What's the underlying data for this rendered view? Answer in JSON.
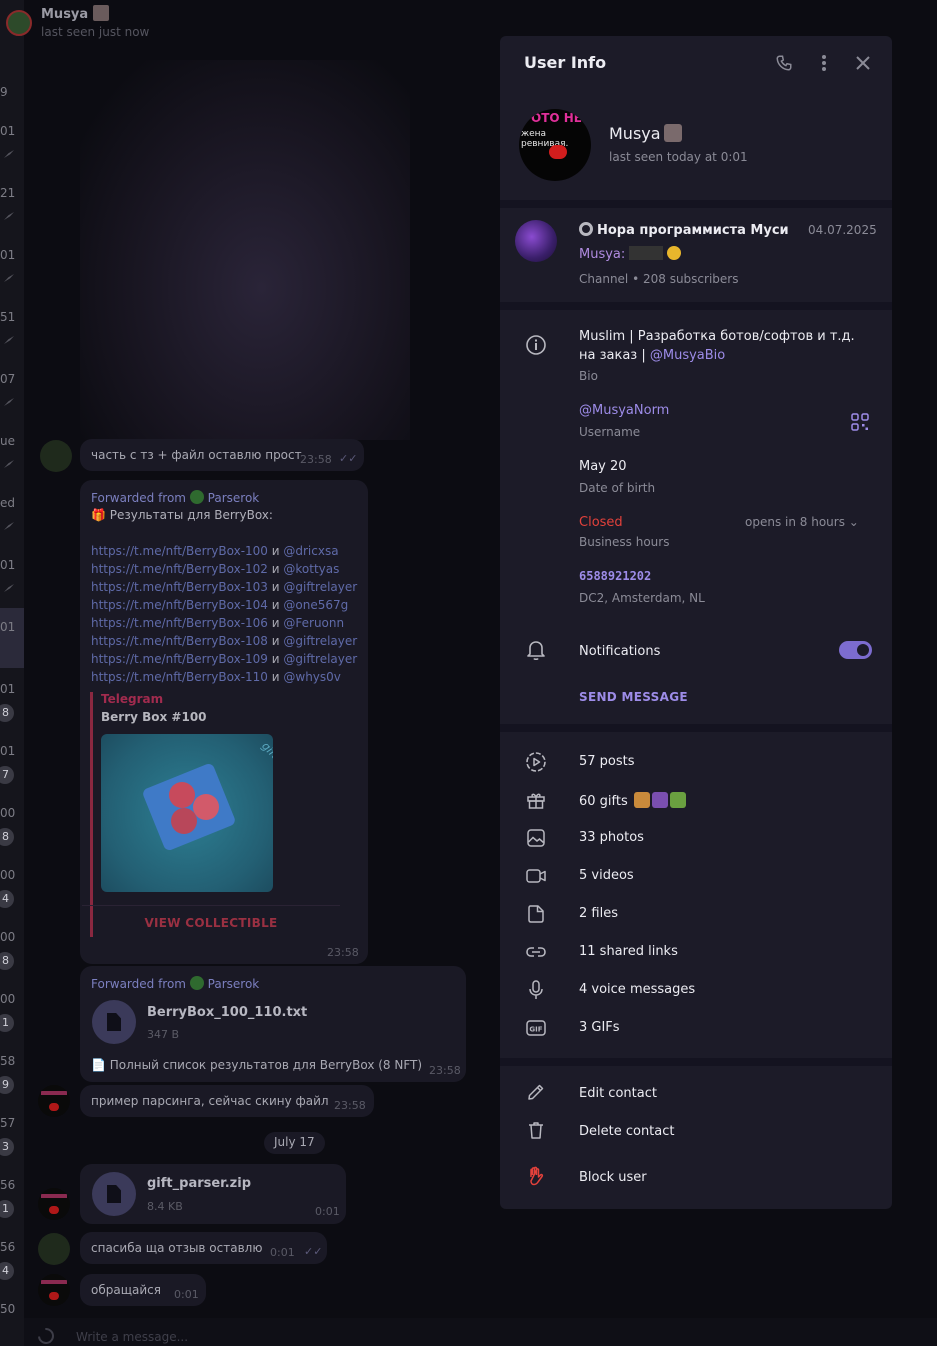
{
  "chat_list": {
    "numbers": [
      "9",
      "01",
      "21",
      "01",
      "51",
      "07",
      "ue",
      "ed",
      "01",
      "01",
      "01",
      "01",
      "00",
      "00",
      "00",
      "00",
      "58",
      "57",
      "56",
      "56",
      "50"
    ],
    "badges": [
      "8",
      "7",
      "8",
      "4",
      "8",
      "1",
      "9",
      "3",
      "1",
      "4"
    ]
  },
  "chat": {
    "title": "Musya",
    "subtitle": "last seen just now",
    "messages": [
      {
        "text": "часть с тз + файл оставлю прост",
        "time": "23:58"
      },
      {
        "forwarded_prefix": "Forwarded from",
        "forwarded_from": "Parserok",
        "heading": "🎁 Результаты для BerryBox:",
        "links": [
          {
            "url": "https://t.me/nft/BerryBox-100",
            "sep": " и ",
            "user": "@dricxsa"
          },
          {
            "url": "https://t.me/nft/BerryBox-102",
            "sep": " и ",
            "user": "@kottyas"
          },
          {
            "url": "https://t.me/nft/BerryBox-103",
            "sep": " и ",
            "user": "@giftrelayer"
          },
          {
            "url": "https://t.me/nft/BerryBox-104",
            "sep": " и ",
            "user": "@one567g"
          },
          {
            "url": "https://t.me/nft/BerryBox-106",
            "sep": " и ",
            "user": "@Feruonn"
          },
          {
            "url": "https://t.me/nft/BerryBox-108",
            "sep": " и ",
            "user": "@giftrelayer"
          },
          {
            "url": "https://t.me/nft/BerryBox-109",
            "sep": " и ",
            "user": "@giftrelayer"
          },
          {
            "url": "https://t.me/nft/BerryBox-110",
            "sep": " и ",
            "user": "@whys0v"
          }
        ],
        "preview_source": "Telegram",
        "preview_title": "Berry Box #100",
        "preview_ribbon": "gift",
        "preview_button": "VIEW COLLECTIBLE",
        "time": "23:58"
      },
      {
        "forwarded_prefix": "Forwarded from",
        "forwarded_from": "Parserok",
        "file_name": "BerryBox_100_110.txt",
        "file_size": "347 B",
        "caption": "📄 Полный список результатов для BerryBox (8 NFT)",
        "time": "23:58"
      },
      {
        "text": "пример парсинга, сейчас скину файл",
        "time": "23:58"
      },
      {
        "file_name": "gift_parser.zip",
        "file_size": "8.4 KB",
        "time": "0:01"
      },
      {
        "text": "спасиба ща отзыв оставлю",
        "time": "0:01"
      },
      {
        "text": "обращайся",
        "time": "0:01"
      }
    ],
    "date_separator": "July 17",
    "composer_placeholder": "Write a message..."
  },
  "user_info": {
    "title": "User Info",
    "name": "Musya",
    "status": "last seen today at 0:01",
    "avatar_text_line1": "ОТО НЕ",
    "avatar_text_line2": "жена ревнивая.",
    "channel": {
      "name": "Нора программиста Муси",
      "date": "04.07.2025",
      "last_msg_author": "Musya:",
      "meta": "Channel • 208 subscribers"
    },
    "bio_text": "Muslim | Разработка ботов/софтов и т.д. на заказ | ",
    "bio_link": "@MusyaBio",
    "bio_label": "Bio",
    "username": "@MusyaNorm",
    "username_label": "Username",
    "birth": "May 20",
    "birth_label": "Date of birth",
    "hours_status": "Closed",
    "hours_note": "opens in 8 hours",
    "hours_label": "Business hours",
    "phone": "6588921202",
    "phone_label": "DC2, Amsterdam, NL",
    "notifications_label": "Notifications",
    "notifications_on": true,
    "send_message": "SEND MESSAGE",
    "media": [
      {
        "icon": "posts-icon",
        "label": "57 posts"
      },
      {
        "icon": "gift-icon",
        "label": "60 gifts"
      },
      {
        "icon": "photo-icon",
        "label": "33 photos"
      },
      {
        "icon": "video-icon",
        "label": "5 videos"
      },
      {
        "icon": "file-icon",
        "label": "2 files"
      },
      {
        "icon": "link-icon",
        "label": "11 shared links"
      },
      {
        "icon": "mic-icon",
        "label": "4 voice messages"
      },
      {
        "icon": "gif-icon",
        "label": "3 GIFs"
      }
    ],
    "actions": {
      "edit": "Edit contact",
      "delete": "Delete contact",
      "block": "Block user"
    }
  },
  "colors": {
    "accent": "#9d8ce8",
    "danger": "#e2413b",
    "panel_bg": "#1c1b28"
  }
}
